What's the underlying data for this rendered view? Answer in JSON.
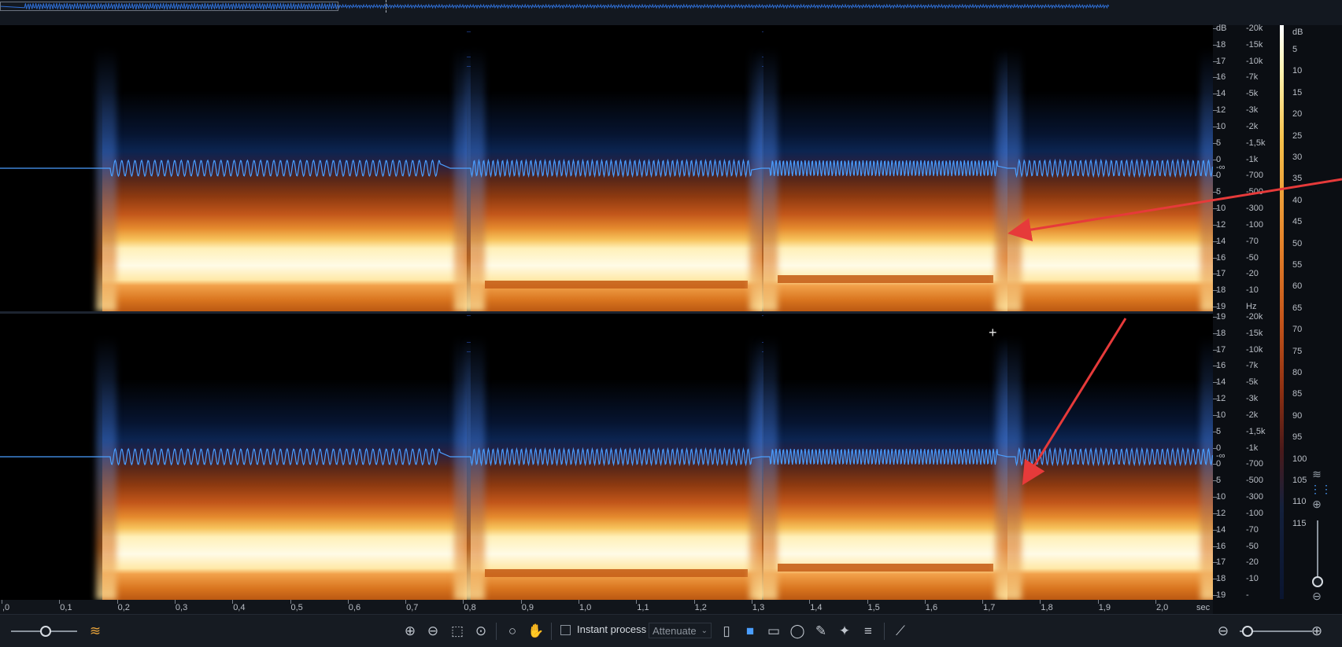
{
  "colors": {
    "waveform": "#4a9eff",
    "arrow": "#e63a3a",
    "accent": "#e8a33a",
    "background": "#000000"
  },
  "freq_scale_ch1": {
    "db_labels": [
      "dB",
      "18",
      "17",
      "16",
      "14",
      "12",
      "10",
      "5",
      "0",
      "0",
      "5",
      "10",
      "12",
      "14",
      "16",
      "17",
      "18",
      "19"
    ],
    "hz_labels": [
      "-20k",
      "-15k",
      "-10k",
      "-7k",
      "-5k",
      "-3k",
      "-2k",
      "-1,5k",
      "-1k",
      "-700",
      "-500",
      "-300",
      "-100",
      "-70",
      "-50",
      "-20",
      "-10",
      "Hz"
    ],
    "infinity": "-∞"
  },
  "freq_scale_ch2": {
    "db_labels": [
      "19",
      "18",
      "17",
      "16",
      "14",
      "12",
      "10",
      "5",
      "0",
      "0",
      "5",
      "10",
      "12",
      "14",
      "16",
      "17",
      "18",
      "19"
    ],
    "hz_labels": [
      "-20k",
      "-15k",
      "-10k",
      "-7k",
      "-5k",
      "-3k",
      "-2k",
      "-1,5k",
      "-1k",
      "-700",
      "-500",
      "-300",
      "-100",
      "-70",
      "-50",
      "-20",
      "-10",
      "-"
    ],
    "infinity": "-∞"
  },
  "colorbar": {
    "header": "dB",
    "labels": [
      "5",
      "10",
      "15",
      "20",
      "25",
      "30",
      "35",
      "40",
      "45",
      "50",
      "55",
      "60",
      "65",
      "70",
      "75",
      "80",
      "85",
      "90",
      "95",
      "100",
      "105",
      "110",
      "115"
    ]
  },
  "timeline": {
    "labels": [
      ",0",
      "0,1",
      "0,2",
      "0,3",
      "0,4",
      "0,5",
      "0,6",
      "0,7",
      "0,8",
      "0,9",
      "1,0",
      "1,1",
      "1,2",
      "1,3",
      "1,4",
      "1,5",
      "1,6",
      "1,7",
      "1,8",
      "1,9",
      "2,0"
    ],
    "unit": "sec"
  },
  "toolbar": {
    "instant_process_label": "Instant process",
    "instant_process_checked": false,
    "mode_value": "Attenuate",
    "icons": [
      "zoom-in-icon",
      "zoom-out-icon",
      "zoom-selection-icon",
      "zoom-fit-icon",
      "magnify-icon",
      "hand-icon",
      "time-selection-icon",
      "rectangle-selection-icon",
      "frequency-selection-icon",
      "lasso-icon",
      "brush-icon",
      "magic-wand-icon",
      "harmonic-selection-icon",
      "envelope-icon"
    ]
  },
  "zoom_slider_left": {
    "value": 0.5
  },
  "zoom_slider_right": {
    "value": 0.15
  }
}
